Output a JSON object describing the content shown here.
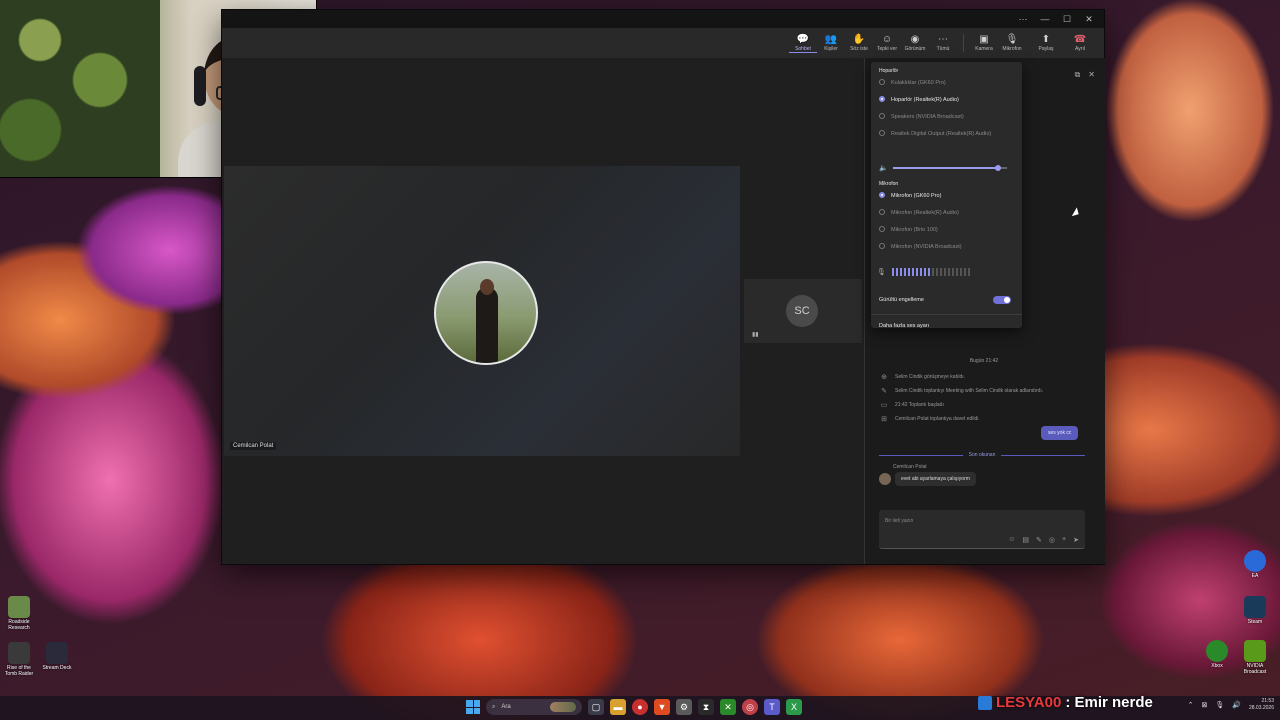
{
  "toolbar": {
    "buttons": [
      {
        "label": "Sohbet",
        "icon": "chat-icon"
      },
      {
        "label": "Kişiler",
        "icon": "people-icon"
      },
      {
        "label": "Söz iste",
        "icon": "raise-hand-icon"
      },
      {
        "label": "Tepki ver",
        "icon": "reaction-icon"
      },
      {
        "label": "Görünüm",
        "icon": "view-icon"
      },
      {
        "label": "Tümü",
        "icon": "more-icon"
      },
      {
        "label": "Kamera",
        "icon": "camera-icon"
      },
      {
        "label": "Mikrofon",
        "icon": "mic-icon"
      },
      {
        "label": "Paylaş",
        "icon": "share-icon"
      },
      {
        "label": "Ayrıl",
        "icon": "leave-icon"
      }
    ]
  },
  "stage": {
    "main_participant": "Cemilcan Polat",
    "side_participant_initials": "SC"
  },
  "audio_menu": {
    "speaker_section": "Hoparlör",
    "speakers": [
      {
        "label": "Kulaklıklar (GK60 Pro)",
        "selected": false
      },
      {
        "label": "Hoparlör (Realtek(R) Audio)",
        "selected": true
      },
      {
        "label": "Speakers (NVIDIA Broadcast)",
        "selected": false
      },
      {
        "label": "Realtek Digital Output (Realtek(R) Audio)",
        "selected": false
      }
    ],
    "volume_fraction": 0.92,
    "mic_section": "Mikrofon",
    "mics": [
      {
        "label": "Mikrofon (GK60 Pro)",
        "selected": true
      },
      {
        "label": "Mikrofon (Realtek(R) Audio)",
        "selected": false
      },
      {
        "label": "Mikrofon (Brio 100)",
        "selected": false
      },
      {
        "label": "Mikrofon (NVIDIA Broadcast)",
        "selected": false
      }
    ],
    "mic_level_fraction": 0.5,
    "noise_suppression_label": "Gürültü engelleme",
    "noise_suppression_on": true,
    "more_audio_label": "Daha fazla ses ayarı"
  },
  "chat": {
    "date_header": "Bugün 21:42",
    "log": [
      {
        "icon": "person-add-icon",
        "text": "Selim Cindik görüşmeye katıldı."
      },
      {
        "icon": "pencil-icon",
        "text": "Selim Cindik toplantıyı Meeting with Selim Cindik olarak adlandırdı."
      },
      {
        "icon": "video-icon",
        "text": "21:42   Toplantı başladı"
      },
      {
        "icon": "invite-icon",
        "text": "Cemilcan Polat toplantıya davet edildi."
      }
    ],
    "my_message": "ses yok cc",
    "seen_label": "Son okunan",
    "incoming_sender": "Cemilcan Polat",
    "incoming_text": "evet abi ayarlamaya çalışıyorm",
    "composer_placeholder": "Bir ileti yazın"
  },
  "desktop_icons": [
    {
      "label": "Roadside Research",
      "color": "#6a8a4a"
    },
    {
      "label": "Rise of the Tomb Raider",
      "color": "#3a3a3a"
    },
    {
      "label": "Stream Deck",
      "color": "#2a2a3a"
    },
    {
      "label": "Xbox",
      "color": "#2a8a2a"
    },
    {
      "label": "Steam",
      "color": "#1a3a5a"
    },
    {
      "label": "NVIDIA Broadcast",
      "color": "#5a9a1a"
    },
    {
      "label": "EA",
      "color": "#2a6ad8"
    }
  ],
  "taskbar": {
    "search_placeholder": "Ara",
    "time": "21:53",
    "date": "28.03.2026"
  },
  "overlay": {
    "streamer_name": "LESYA00",
    "message": ": Emir nerde"
  }
}
